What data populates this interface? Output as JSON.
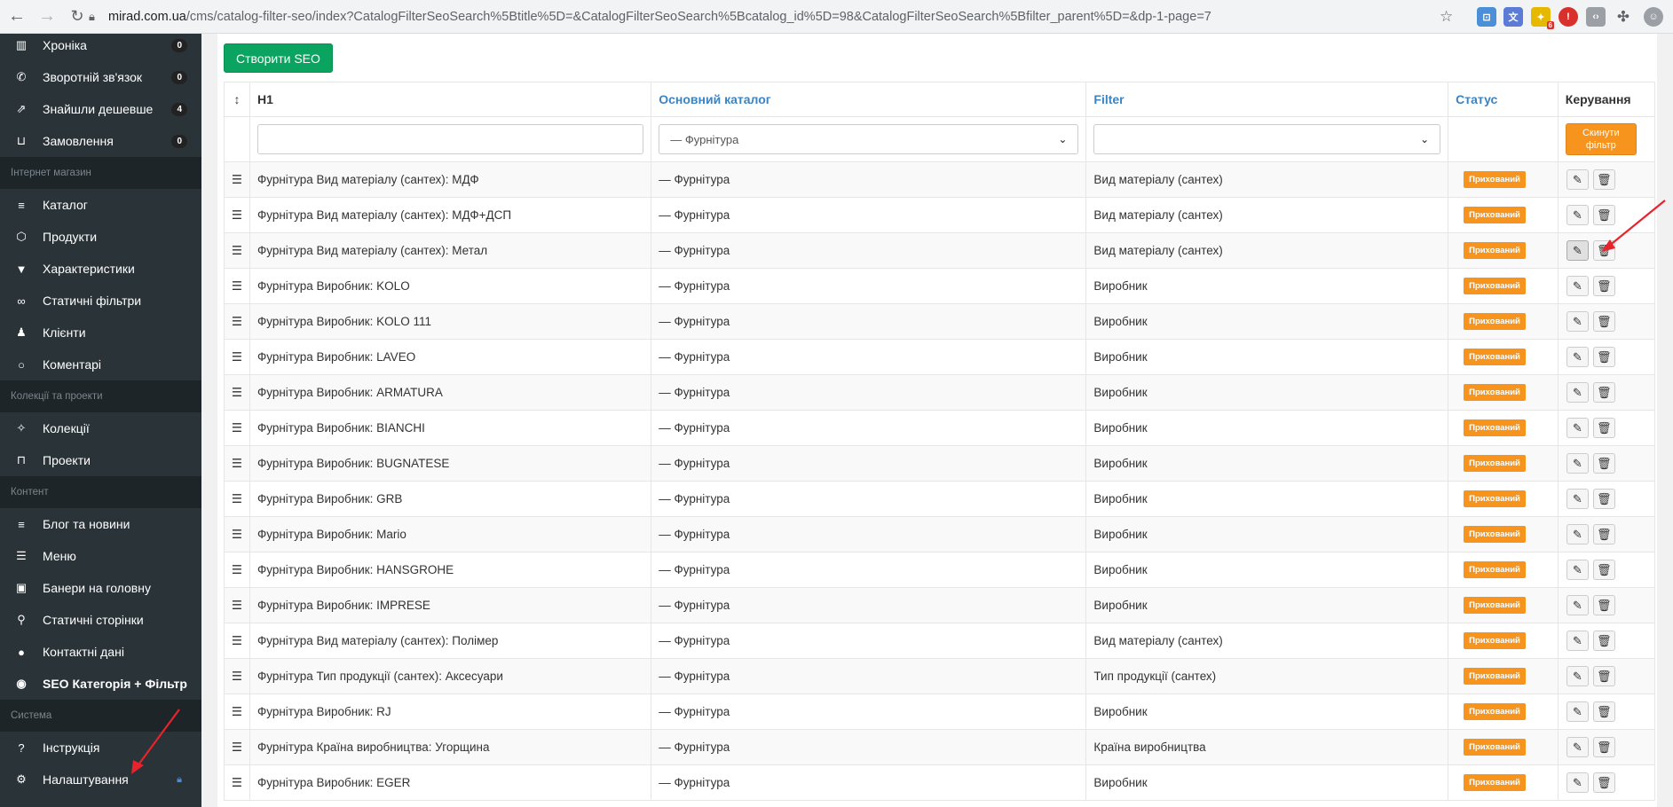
{
  "browser": {
    "url_host": "mirad.com.ua",
    "url_path": "/cms/catalog-filter-seo/index?CatalogFilterSeoSearch%5Btitle%5D=&CatalogFilterSeoSearch%5Bcatalog_id%5D=98&CatalogFilterSeoSearch%5Bfilter_parent%5D=&dp-1-page=7",
    "ext_badge": "6"
  },
  "sidebar": {
    "items_top": [
      {
        "icon": "chart-bar-icon",
        "glyph": "▥",
        "label": "Хроніка",
        "count": "0"
      },
      {
        "icon": "phone-icon",
        "glyph": "✆",
        "label": "Зворотній зв'язок",
        "count": "0"
      },
      {
        "icon": "external-link-icon",
        "glyph": "⇗",
        "label": "Знайшли дешевше",
        "count": "4"
      },
      {
        "icon": "basket-icon",
        "glyph": "⊔",
        "label": "Замовлення",
        "count": "0"
      }
    ],
    "section_shop": "Інтернет магазин",
    "items_shop": [
      {
        "icon": "list-icon",
        "glyph": "≡",
        "label": "Каталог"
      },
      {
        "icon": "cube-icon",
        "glyph": "⬡",
        "label": "Продукти"
      },
      {
        "icon": "filter-icon",
        "glyph": "▼",
        "label": "Характеристики"
      },
      {
        "icon": "link-icon",
        "glyph": "∞",
        "label": "Статичні фільтри"
      },
      {
        "icon": "users-icon",
        "glyph": "♟",
        "label": "Клієнти"
      },
      {
        "icon": "comment-icon",
        "glyph": "○",
        "label": "Коментарі"
      }
    ],
    "section_collections": "Колекції та проекти",
    "items_collections": [
      {
        "icon": "magic-icon",
        "glyph": "✧",
        "label": "Колекції"
      },
      {
        "icon": "unlock-icon",
        "glyph": "⊓",
        "label": "Проекти"
      }
    ],
    "section_content": "Контент",
    "items_content": [
      {
        "icon": "align-left-icon",
        "glyph": "≡",
        "label": "Блог та новини"
      },
      {
        "icon": "menu-icon",
        "glyph": "☰",
        "label": "Меню"
      },
      {
        "icon": "image-icon",
        "glyph": "▣",
        "label": "Банери на головну"
      },
      {
        "icon": "pin-icon",
        "glyph": "⚲",
        "label": "Статичні сторінки"
      },
      {
        "icon": "info-icon",
        "glyph": "●",
        "label": "Контактні дані"
      },
      {
        "icon": "globe-icon",
        "glyph": "◉",
        "label": "SEO Категорія + Фільтр"
      }
    ],
    "section_system": "Система",
    "items_system": [
      {
        "icon": "question-icon",
        "glyph": "?",
        "label": "Інструкція"
      },
      {
        "icon": "gear-icon",
        "glyph": "⚙",
        "label": "Налаштування"
      }
    ]
  },
  "toolbar": {
    "create_label": "Створити SEO"
  },
  "table": {
    "headers": {
      "h1": "H1",
      "catalog": "Основний каталог",
      "filter": "Filter",
      "status": "Статус",
      "manage": "Керування"
    },
    "filter_row": {
      "title_value": "",
      "catalog_value": "— Фурнітура",
      "filter_value": "",
      "reset_label": "Скинути фільтр"
    },
    "rows": [
      {
        "h1": "Фурнітура Вид матеріалу (сантех): МДФ",
        "catalog": "— Фурнітура",
        "filter": "Вид матеріалу (сантех)",
        "status": "Прихований"
      },
      {
        "h1": "Фурнітура Вид матеріалу (сантех): МДФ+ДСП",
        "catalog": "— Фурнітура",
        "filter": "Вид матеріалу (сантех)",
        "status": "Прихований"
      },
      {
        "h1": "Фурнітура Вид матеріалу (сантех): Метал",
        "catalog": "— Фурнітура",
        "filter": "Вид матеріалу (сантех)",
        "status": "Прихований"
      },
      {
        "h1": "Фурнітура Виробник: KOLO",
        "catalog": "— Фурнітура",
        "filter": "Виробник",
        "status": "Прихований"
      },
      {
        "h1": "Фурнітура Виробник: KOLO 111",
        "catalog": "— Фурнітура",
        "filter": "Виробник",
        "status": "Прихований"
      },
      {
        "h1": "Фурнітура Виробник: LAVEO",
        "catalog": "— Фурнітура",
        "filter": "Виробник",
        "status": "Прихований"
      },
      {
        "h1": "Фурнітура Виробник: ARMATURA",
        "catalog": "— Фурнітура",
        "filter": "Виробник",
        "status": "Прихований"
      },
      {
        "h1": "Фурнітура Виробник: BIANCHI",
        "catalog": "— Фурнітура",
        "filter": "Виробник",
        "status": "Прихований"
      },
      {
        "h1": "Фурнітура Виробник: BUGNATESE",
        "catalog": "— Фурнітура",
        "filter": "Виробник",
        "status": "Прихований"
      },
      {
        "h1": "Фурнітура Виробник: GRB",
        "catalog": "— Фурнітура",
        "filter": "Виробник",
        "status": "Прихований"
      },
      {
        "h1": "Фурнітура Виробник: Mario",
        "catalog": "— Фурнітура",
        "filter": "Виробник",
        "status": "Прихований"
      },
      {
        "h1": "Фурнітура Виробник: HANSGROHE",
        "catalog": "— Фурнітура",
        "filter": "Виробник",
        "status": "Прихований"
      },
      {
        "h1": "Фурнітура Виробник: IMPRESE",
        "catalog": "— Фурнітура",
        "filter": "Виробник",
        "status": "Прихований"
      },
      {
        "h1": "Фурнітура Вид матеріалу (сантех): Полімер",
        "catalog": "— Фурнітура",
        "filter": "Вид матеріалу (сантех)",
        "status": "Прихований"
      },
      {
        "h1": "Фурнітура Тип продукції (сантех): Аксесуари",
        "catalog": "— Фурнітура",
        "filter": "Тип продукції (сантех)",
        "status": "Прихований"
      },
      {
        "h1": "Фурнітура Виробник: RJ",
        "catalog": "— Фурнітура",
        "filter": "Виробник",
        "status": "Прихований"
      },
      {
        "h1": "Фурнітура Країна виробництва: Угорщина",
        "catalog": "— Фурнітура",
        "filter": "Країна виробництва",
        "status": "Прихований"
      },
      {
        "h1": "Фурнітура Виробник: EGER",
        "catalog": "— Фурнітура",
        "filter": "Виробник",
        "status": "Прихований"
      }
    ]
  },
  "colors": {
    "accent_green": "#0ba360",
    "status_orange": "#f7941d",
    "annotation_red": "#e8232c",
    "sidebar_bg": "#2a3338"
  }
}
